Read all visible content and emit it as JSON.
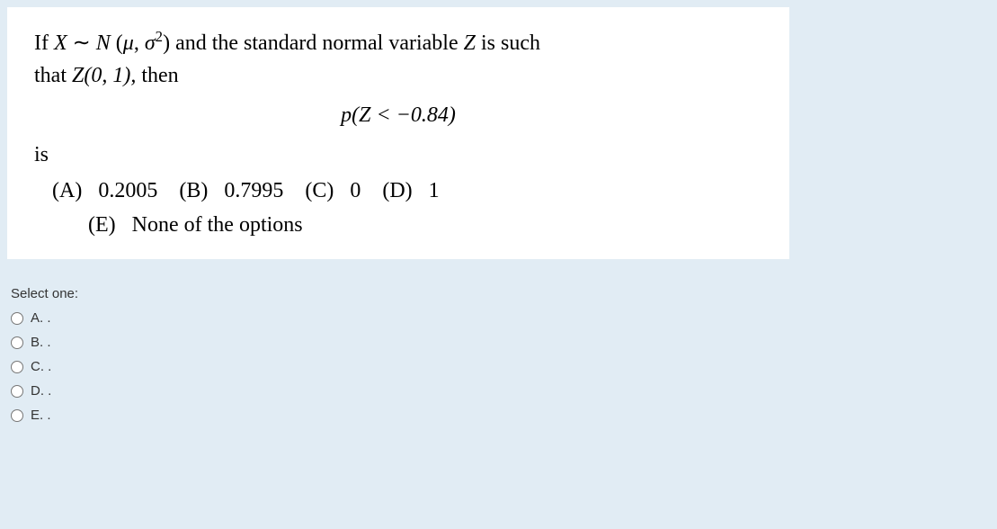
{
  "question": {
    "line1_pre": "If ",
    "line1_x": "X",
    "line1_tilde": " ∼ ",
    "line1_dist": "N",
    "line1_params": "(μ, σ²)",
    "line1_mid": " and the standard normal variable ",
    "line1_z": "Z",
    "line1_post": " is such",
    "line2_pre": "that ",
    "line2_zdist": "Z(0, 1),",
    "line2_post": " then",
    "formula": "p(Z < −0.84)",
    "is_text": "is",
    "opt_a_label": "(A)",
    "opt_a_val": "0.2005",
    "opt_b_label": "(B)",
    "opt_b_val": "0.7995",
    "opt_c_label": "(C)",
    "opt_c_val": "0",
    "opt_d_label": "(D)",
    "opt_d_val": "1",
    "opt_e_label": "(E)",
    "opt_e_val": "None of the options"
  },
  "select": {
    "prompt": "Select one:",
    "options": {
      "a": "A. .",
      "b": "B. .",
      "c": "C. .",
      "d": "D. .",
      "e": "E. ."
    }
  }
}
